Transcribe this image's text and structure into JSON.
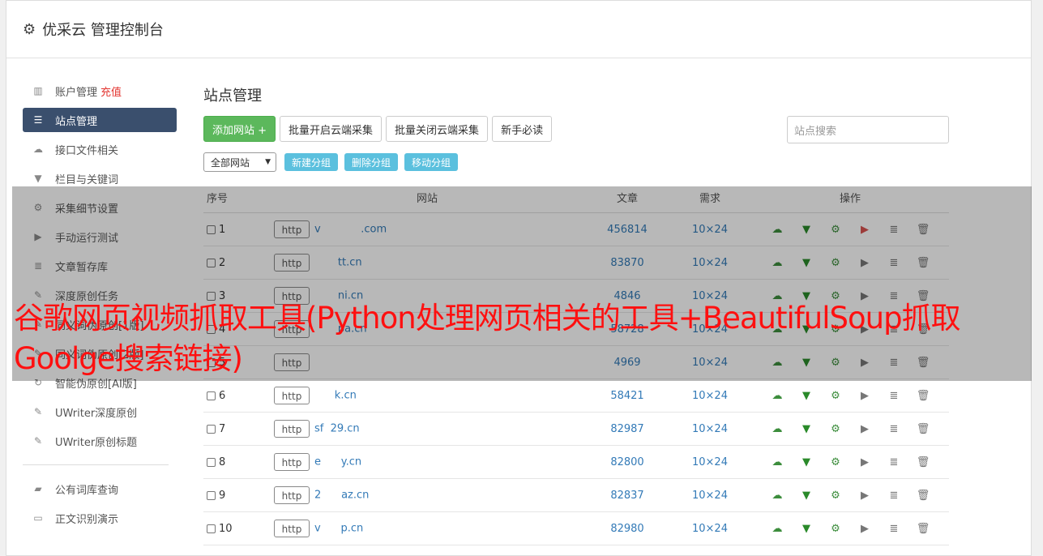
{
  "app": {
    "title": "优采云 管理控制台"
  },
  "sidebar": {
    "items": [
      {
        "icon": "bar-chart-icon",
        "label": "账户管理",
        "extra": "充值",
        "active": false
      },
      {
        "icon": "server-icon",
        "label": "站点管理",
        "active": true
      },
      {
        "icon": "cloud-upload-icon",
        "label": "接口文件相关",
        "active": false
      },
      {
        "icon": "filter-icon",
        "label": "栏目与关键词",
        "active": false
      },
      {
        "icon": "gears-icon",
        "label": "采集细节设置",
        "active": false
      },
      {
        "icon": "play-icon",
        "label": "手动运行测试",
        "active": false
      },
      {
        "icon": "database-icon",
        "label": "文章暂存库",
        "active": false
      },
      {
        "icon": "edit-icon",
        "label": "深度原创任务",
        "active": false
      },
      {
        "icon": "edit-icon",
        "label": "同义词伪原创[1版]",
        "active": false
      },
      {
        "icon": "edit-icon",
        "label": "同义词伪原创[2版]",
        "active": false
      },
      {
        "icon": "refresh-icon",
        "label": "智能伪原创[AI版]",
        "active": false
      },
      {
        "icon": "edit-icon",
        "label": "UWriter深度原创",
        "active": false
      },
      {
        "icon": "edit-icon",
        "label": "UWriter原创标题",
        "active": false
      }
    ],
    "bottom_items": [
      {
        "icon": "book-icon",
        "label": "公有词库查询"
      },
      {
        "icon": "monitor-icon",
        "label": "正文识别演示"
      }
    ]
  },
  "main": {
    "title": "站点管理",
    "toolbar": {
      "add_site": "添加网站 +",
      "batch_open": "批量开启云端采集",
      "batch_close": "批量关闭云端采集",
      "newbie": "新手必读"
    },
    "search": {
      "placeholder": "站点搜索"
    },
    "group_select": {
      "value": "全部网站"
    },
    "group_buttons": {
      "new": "新建分组",
      "delete": "删除分组",
      "move": "移动分组"
    },
    "table": {
      "headers": {
        "no": "序号",
        "site": "网站",
        "articles": "文章",
        "demand": "需求",
        "ops": "操作"
      },
      "rows": [
        {
          "no": "1",
          "protocol": "http",
          "domain": "v            .com",
          "articles": "456814",
          "demand": "10×24",
          "running": true
        },
        {
          "no": "2",
          "protocol": "http",
          "domain": "       tt.cn",
          "articles": "83870",
          "demand": "10×24",
          "running": false
        },
        {
          "no": "3",
          "protocol": "http",
          "domain": "       ni.cn",
          "articles": "4846",
          "demand": "10×24",
          "running": false
        },
        {
          "no": "4",
          "protocol": "http",
          "domain": "       pa.cn",
          "articles": "58728",
          "demand": "10×24",
          "running": false
        },
        {
          "no": "5",
          "protocol": "http",
          "domain": "       ",
          "articles": "4969",
          "demand": "10×24",
          "running": false
        },
        {
          "no": "6",
          "protocol": "http",
          "domain": "      k.cn",
          "articles": "58421",
          "demand": "10×24",
          "running": false
        },
        {
          "no": "7",
          "protocol": "http",
          "domain": "sf  29.cn",
          "articles": "82987",
          "demand": "10×24",
          "running": false
        },
        {
          "no": "8",
          "protocol": "http",
          "domain": "e      y.cn",
          "articles": "82800",
          "demand": "10×24",
          "running": false
        },
        {
          "no": "9",
          "protocol": "http",
          "domain": "2      az.cn",
          "articles": "82837",
          "demand": "10×24",
          "running": false
        },
        {
          "no": "10",
          "protocol": "http",
          "domain": "v      p.cn",
          "articles": "82980",
          "demand": "10×24",
          "running": false
        }
      ]
    }
  },
  "overlay": {
    "caption": "谷歌网页视频抓取工具(Python处理网页相关的工具+BeautifulSoup抓取Goolge搜索链接)"
  }
}
